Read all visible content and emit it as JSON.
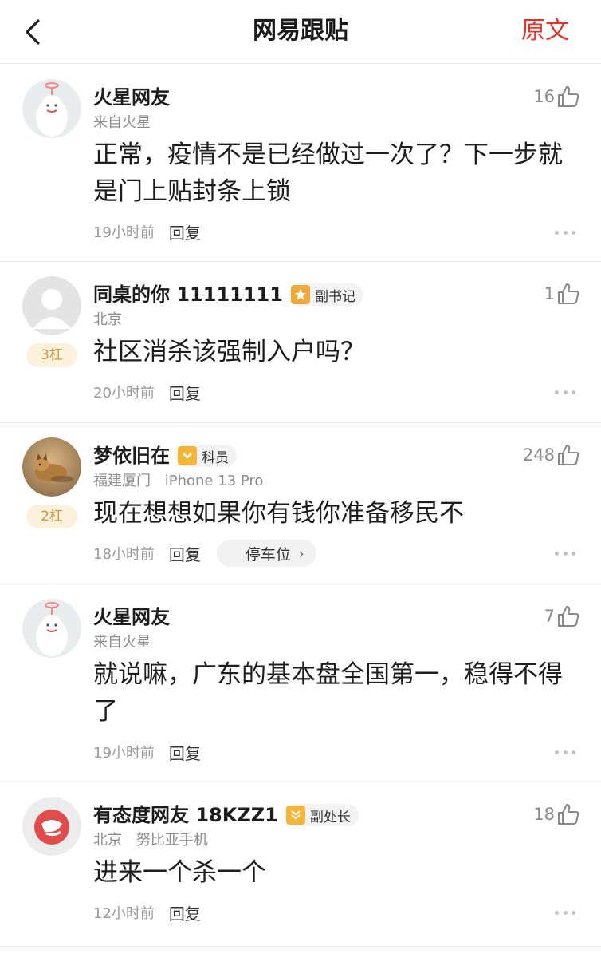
{
  "header": {
    "back_icon": "chevron-left-icon",
    "title": "网易跟贴",
    "original_label": "原文",
    "accent_color": "#e0352b"
  },
  "comments": [
    {
      "nickname": "火星网友",
      "location": "来自火星",
      "device": "",
      "likes": "16",
      "content": "正常，疫情不是已经做过一次了？下一步就是门上贴封条上锁",
      "time": "19小时前",
      "reply_label": "回复",
      "avatar": "martian-avatar"
    },
    {
      "nickname": "同桌的你 11111111",
      "badge": "副书记",
      "badge_icon": "star-badge-icon",
      "location": "北京",
      "device": "",
      "floor": "3杠",
      "likes": "1",
      "content": "社区消杀该强制入户吗？",
      "time": "20小时前",
      "reply_label": "回复",
      "avatar": "default-user-avatar"
    },
    {
      "nickname": "梦依旧在",
      "badge": "科员",
      "badge_icon": "chevron-rank-icon",
      "location": "福建厦门",
      "device": "iPhone 13 Pro",
      "floor": "2杠",
      "likes": "248",
      "content": "现在想想如果你有钱你准备移民不",
      "time": "18小时前",
      "reply_label": "回复",
      "tag_label": "停车位",
      "avatar": "dog-photo-avatar"
    },
    {
      "nickname": "火星网友",
      "location": "来自火星",
      "device": "",
      "likes": "7",
      "content": "就说嘛，广东的基本盘全国第一，稳得不得了",
      "time": "19小时前",
      "reply_label": "回复",
      "avatar": "martian-avatar"
    },
    {
      "nickname": "有态度网友 18KZZ1",
      "badge": "副处长",
      "badge_icon": "double-chevron-rank-icon",
      "location": "北京",
      "device": "努比亚手机",
      "likes": "18",
      "content": "进来一个杀一个",
      "time": "12小时前",
      "reply_label": "回复",
      "avatar": "netease-logo-avatar"
    }
  ]
}
